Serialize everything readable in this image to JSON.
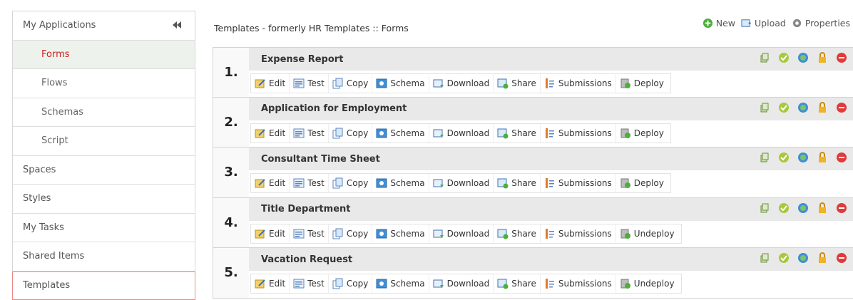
{
  "sidebar": {
    "items": [
      {
        "label": "My Applications",
        "level": 0
      },
      {
        "label": "Forms",
        "level": 1,
        "active": true
      },
      {
        "label": "Flows",
        "level": 1
      },
      {
        "label": "Schemas",
        "level": 1
      },
      {
        "label": "Script",
        "level": 1
      },
      {
        "label": "Spaces",
        "level": 0
      },
      {
        "label": "Styles",
        "level": 0
      },
      {
        "label": "My Tasks",
        "level": 0
      },
      {
        "label": "Shared Items",
        "level": 0
      },
      {
        "label": "Templates",
        "level": 0,
        "selected": true
      }
    ]
  },
  "header": {
    "title": "Templates - formerly HR Templates :: Forms",
    "new_label": "New",
    "upload_label": "Upload",
    "properties_label": "Properties"
  },
  "actions": {
    "edit": "Edit",
    "test": "Test",
    "copy": "Copy",
    "schema": "Schema",
    "download": "Download",
    "share": "Share",
    "submissions": "Submissions",
    "deploy": "Deploy",
    "undeploy": "Undeploy"
  },
  "templates": [
    {
      "num": "1.",
      "name": "Expense Report",
      "deploy_label": "Deploy"
    },
    {
      "num": "2.",
      "name": "Application for Employment",
      "deploy_label": "Deploy"
    },
    {
      "num": "3.",
      "name": "Consultant Time Sheet",
      "deploy_label": "Deploy"
    },
    {
      "num": "4.",
      "name": "Title Department",
      "deploy_label": "Undeploy"
    },
    {
      "num": "5.",
      "name": "Vacation Request",
      "deploy_label": "Undeploy"
    }
  ],
  "colors": {
    "active_text": "#cc2222",
    "selected_border": "#e88a8a",
    "row_header_bg": "#e9e9e9"
  }
}
